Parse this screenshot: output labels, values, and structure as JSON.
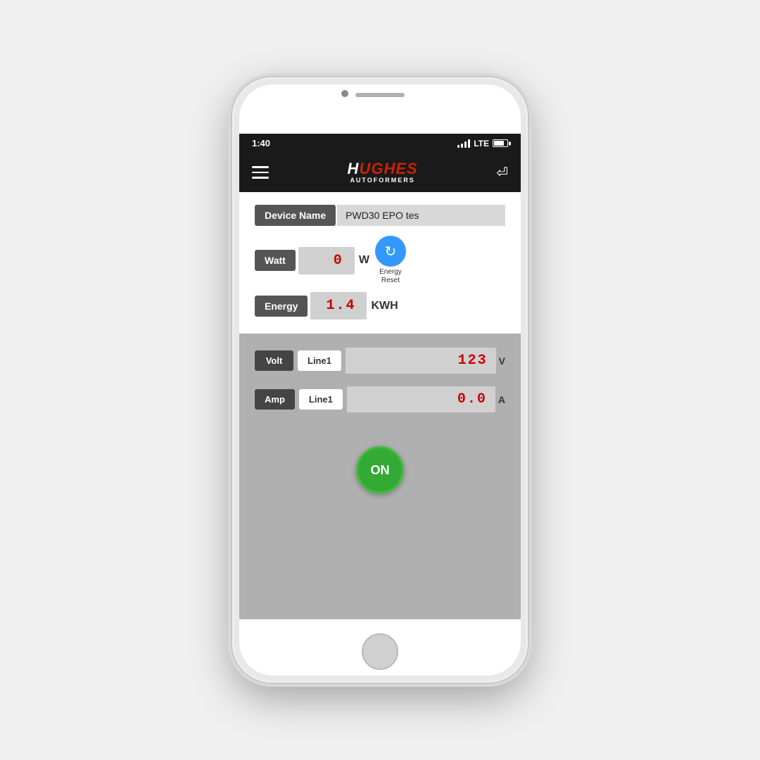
{
  "statusBar": {
    "time": "1:40",
    "signal": "LTE"
  },
  "header": {
    "menuLabel": "menu",
    "logoLine1": "HUGHES",
    "logoLine2": "AUTOFORMERS",
    "backLabel": "back"
  },
  "deviceSection": {
    "deviceNameLabel": "Device Name",
    "deviceNameValue": "PWD30 EPO tes"
  },
  "wattSection": {
    "label": "Watt",
    "value": "0",
    "unit": "W",
    "resetLabel": "Energy\nReset"
  },
  "energySection": {
    "label": "Energy",
    "value": "1.4",
    "unit": "KWH"
  },
  "voltSection": {
    "label": "Volt",
    "lineLabel": "Line1",
    "value": "123",
    "unit": "V"
  },
  "ampSection": {
    "label": "Amp",
    "lineLabel": "Line1",
    "value": "0.0",
    "unit": "A"
  },
  "onButton": {
    "label": "ON"
  }
}
